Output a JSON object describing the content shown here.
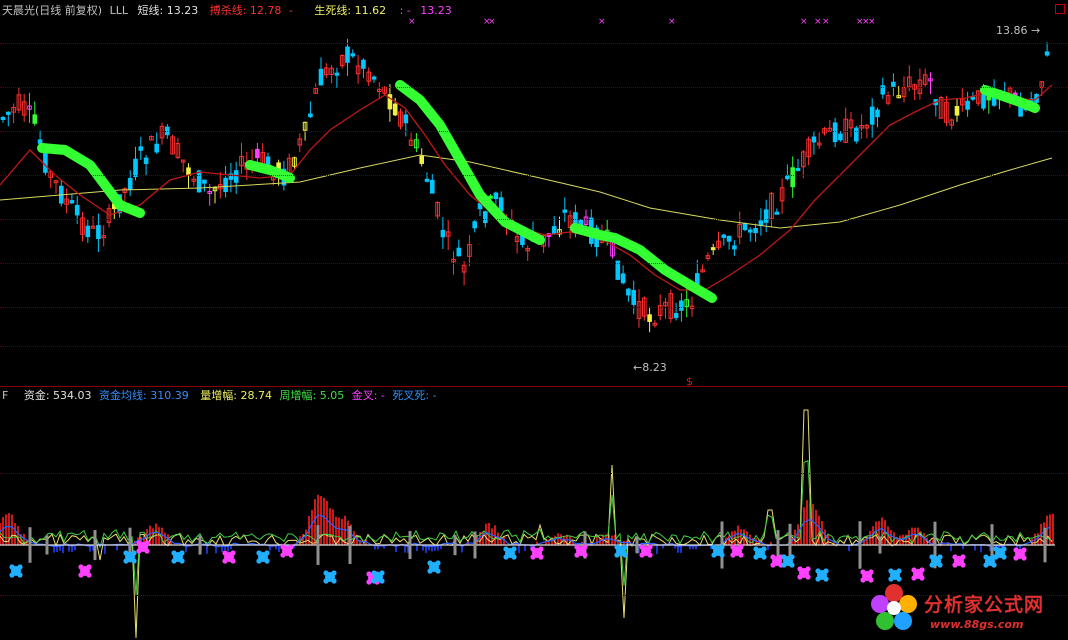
{
  "top": {
    "title": "天晨光(日线 前复权)",
    "indicator": "LLL",
    "short_label": "短线:",
    "short_value": "13.23",
    "kill_label": "搏杀线:",
    "kill_value": "12.78",
    "kill_dash": "-",
    "life_label": "生死线:",
    "life_value": "11.62",
    "extra_label": ": -",
    "extra_value": "13.23",
    "high_label": "13.86",
    "low_label": "8.23"
  },
  "bottom": {
    "prefix": "F",
    "fund_label": "资金:",
    "fund_value": "534.03",
    "fund_avg_label": "资金均线:",
    "fund_avg_value": "310.39",
    "vol_label": "量增幅:",
    "vol_value": "28.74",
    "week_label": "周增幅:",
    "week_value": "5.05",
    "golden_label": "金叉:",
    "golden_value": "-",
    "death_label": "死叉死:",
    "death_value": "-"
  },
  "cursor_mark": "$",
  "watermark": {
    "title": "分析家公式网",
    "url": "www.88gs.com"
  },
  "colors": {
    "up": "#ff3030",
    "down": "#00c8ff",
    "green_band": "#33ff33",
    "ma_long": "#d8d860",
    "ma_red": "#c01818",
    "fund": "#ff2020",
    "pink_marker": "#ff40ff",
    "cyan_marker": "#20b0ff"
  }
}
